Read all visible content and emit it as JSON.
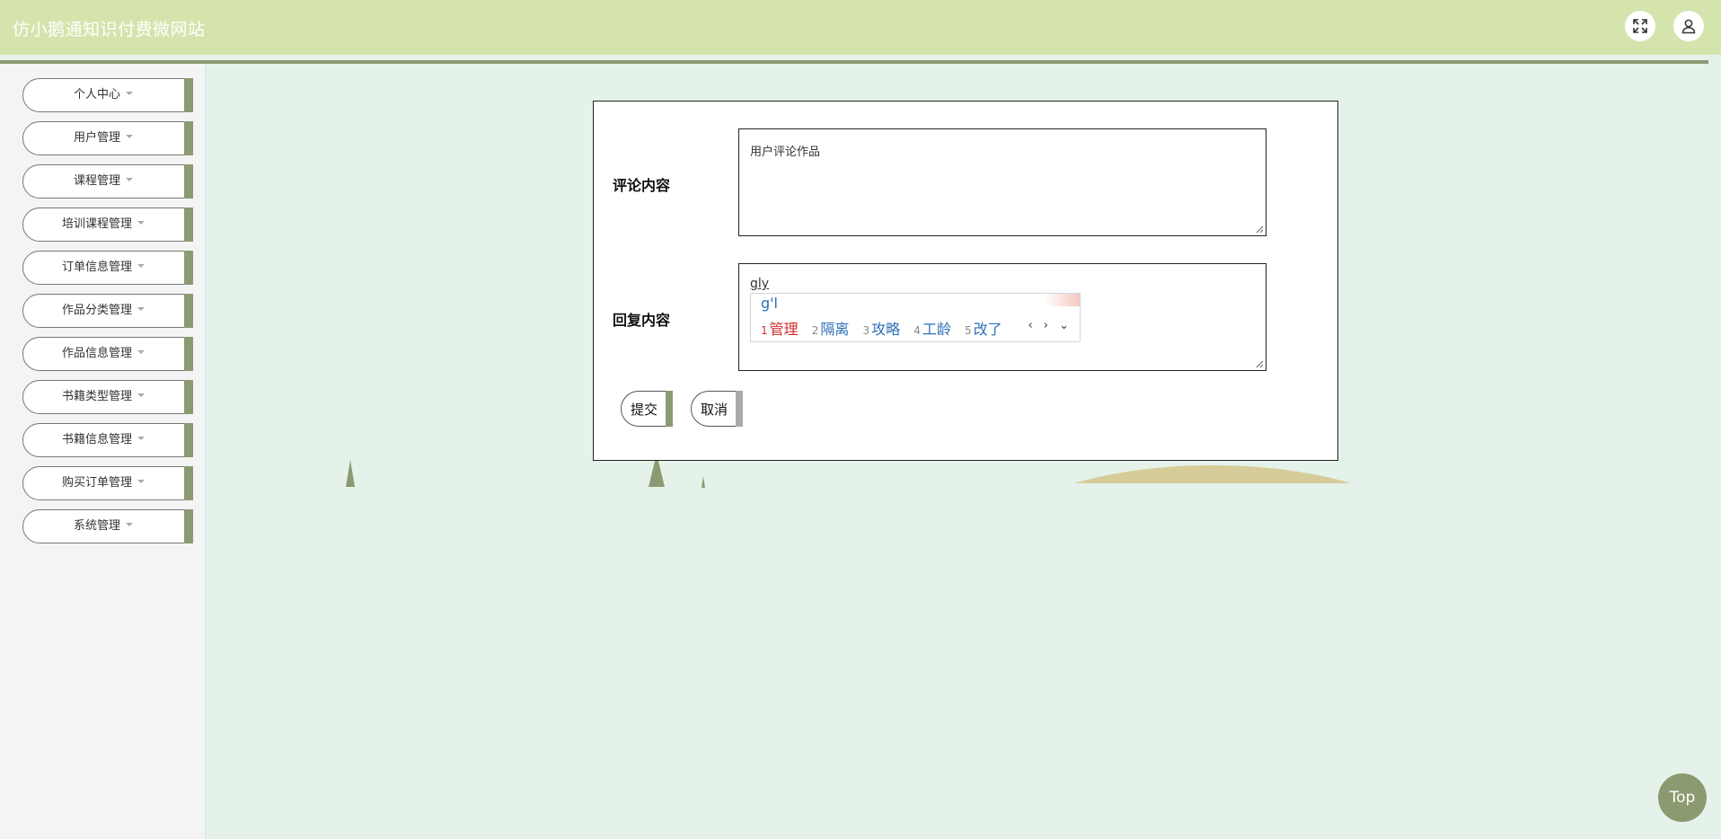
{
  "header": {
    "site_title": "仿小鹅通知识付费微网站",
    "fullscreen_icon": "fullscreen-icon",
    "user_icon": "user-icon",
    "accent_color": "#d5e4ad"
  },
  "sidebar": {
    "items": [
      {
        "label": "个人中心"
      },
      {
        "label": "用户管理"
      },
      {
        "label": "课程管理"
      },
      {
        "label": "培训课程管理"
      },
      {
        "label": "订单信息管理"
      },
      {
        "label": "作品分类管理"
      },
      {
        "label": "作品信息管理"
      },
      {
        "label": "书籍类型管理"
      },
      {
        "label": "书籍信息管理"
      },
      {
        "label": "购买订单管理"
      },
      {
        "label": "系统管理"
      }
    ]
  },
  "form": {
    "comment_label": "评论内容",
    "comment_value": "用户评论作品",
    "reply_label": "回复内容",
    "reply_value": "gly",
    "submit_label": "提交",
    "cancel_label": "取消"
  },
  "ime": {
    "composition": "g'l",
    "candidates": [
      {
        "num": "1",
        "text": "管理"
      },
      {
        "num": "2",
        "text": "隔离"
      },
      {
        "num": "3",
        "text": "攻略"
      },
      {
        "num": "4",
        "text": "工龄"
      },
      {
        "num": "5",
        "text": "改了"
      }
    ],
    "page_arrows": "‹ › ⌄"
  },
  "back_to_top": {
    "label": "Top"
  }
}
